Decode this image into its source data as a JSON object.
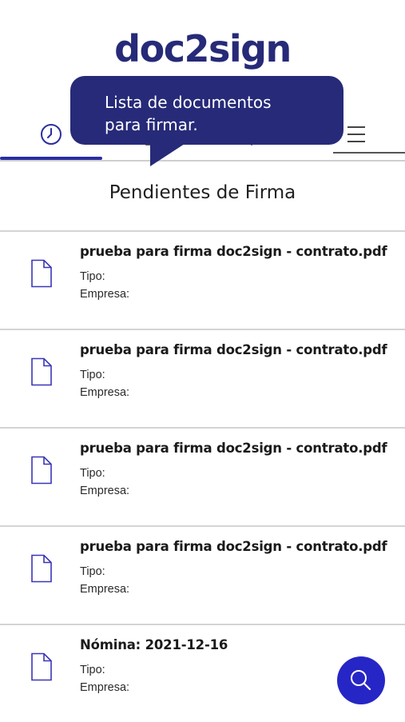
{
  "app": {
    "logo": "doc2sign"
  },
  "tooltip": {
    "line1": "Lista de documentos",
    "line2": "para firmar."
  },
  "tabs": [
    {
      "icon": "clock-icon",
      "active": true
    },
    {
      "icon": "document-tab-icon",
      "active": false
    },
    {
      "icon": "pen-tab-icon",
      "active": false
    },
    {
      "icon": "menu-icon",
      "active": false
    }
  ],
  "section": {
    "title": "Pendientes de Firma"
  },
  "documents": [
    {
      "name": "prueba para firma doc2sign - contrato.pdf",
      "tipo_label": "Tipo:",
      "empresa_label": "Empresa:"
    },
    {
      "name": "prueba para firma doc2sign - contrato.pdf",
      "tipo_label": "Tipo:",
      "empresa_label": "Empresa:"
    },
    {
      "name": "prueba para firma doc2sign - contrato.pdf",
      "tipo_label": "Tipo:",
      "empresa_label": "Empresa:"
    },
    {
      "name": "prueba para firma doc2sign - contrato.pdf",
      "tipo_label": "Tipo:",
      "empresa_label": "Empresa:"
    },
    {
      "name": "Nómina: 2021-12-16",
      "tipo_label": "Tipo:",
      "empresa_label": "Empresa:"
    }
  ],
  "fab": {
    "icon": "search-icon"
  },
  "colors": {
    "brand": "#262a78",
    "accent": "#2626c6",
    "icon_stroke": "#3a36b8"
  }
}
